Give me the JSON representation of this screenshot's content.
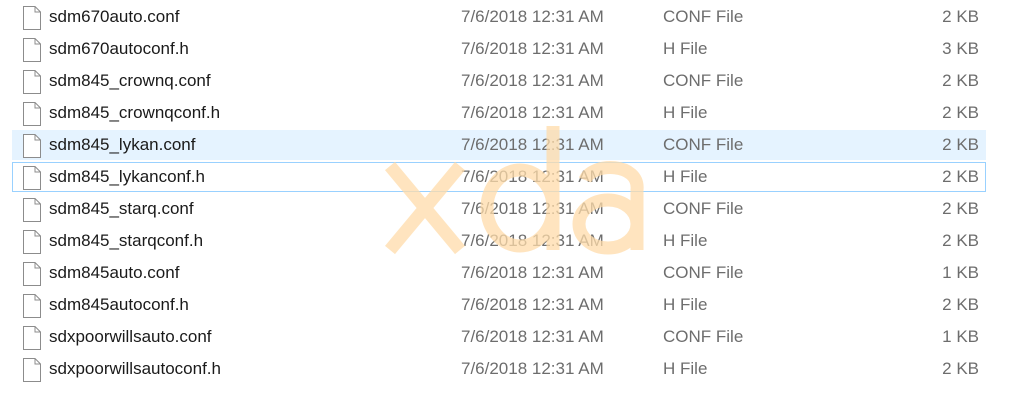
{
  "watermark": "xda",
  "icon": "document-file-icon",
  "colors": {
    "hover_bg": "#e5f3ff",
    "focus_border": "#99d1ff",
    "watermark": "#ffdcaa"
  },
  "files": [
    {
      "name": "sdm670auto.conf",
      "date": "7/6/2018 12:31 AM",
      "type": "CONF File",
      "size": "2 KB"
    },
    {
      "name": "sdm670autoconf.h",
      "date": "7/6/2018 12:31 AM",
      "type": "H File",
      "size": "3 KB"
    },
    {
      "name": "sdm845_crownq.conf",
      "date": "7/6/2018 12:31 AM",
      "type": "CONF File",
      "size": "2 KB"
    },
    {
      "name": "sdm845_crownqconf.h",
      "date": "7/6/2018 12:31 AM",
      "type": "H File",
      "size": "2 KB"
    },
    {
      "name": "sdm845_lykan.conf",
      "date": "7/6/2018 12:31 AM",
      "type": "CONF File",
      "size": "2 KB"
    },
    {
      "name": "sdm845_lykanconf.h",
      "date": "7/6/2018 12:31 AM",
      "type": "H File",
      "size": "2 KB"
    },
    {
      "name": "sdm845_starq.conf",
      "date": "7/6/2018 12:31 AM",
      "type": "CONF File",
      "size": "2 KB"
    },
    {
      "name": "sdm845_starqconf.h",
      "date": "7/6/2018 12:31 AM",
      "type": "H File",
      "size": "2 KB"
    },
    {
      "name": "sdm845auto.conf",
      "date": "7/6/2018 12:31 AM",
      "type": "CONF File",
      "size": "1 KB"
    },
    {
      "name": "sdm845autoconf.h",
      "date": "7/6/2018 12:31 AM",
      "type": "H File",
      "size": "2 KB"
    },
    {
      "name": "sdxpoorwillsauto.conf",
      "date": "7/6/2018 12:31 AM",
      "type": "CONF File",
      "size": "1 KB"
    },
    {
      "name": "sdxpoorwillsautoconf.h",
      "date": "7/6/2018 12:31 AM",
      "type": "H File",
      "size": "2 KB"
    }
  ]
}
